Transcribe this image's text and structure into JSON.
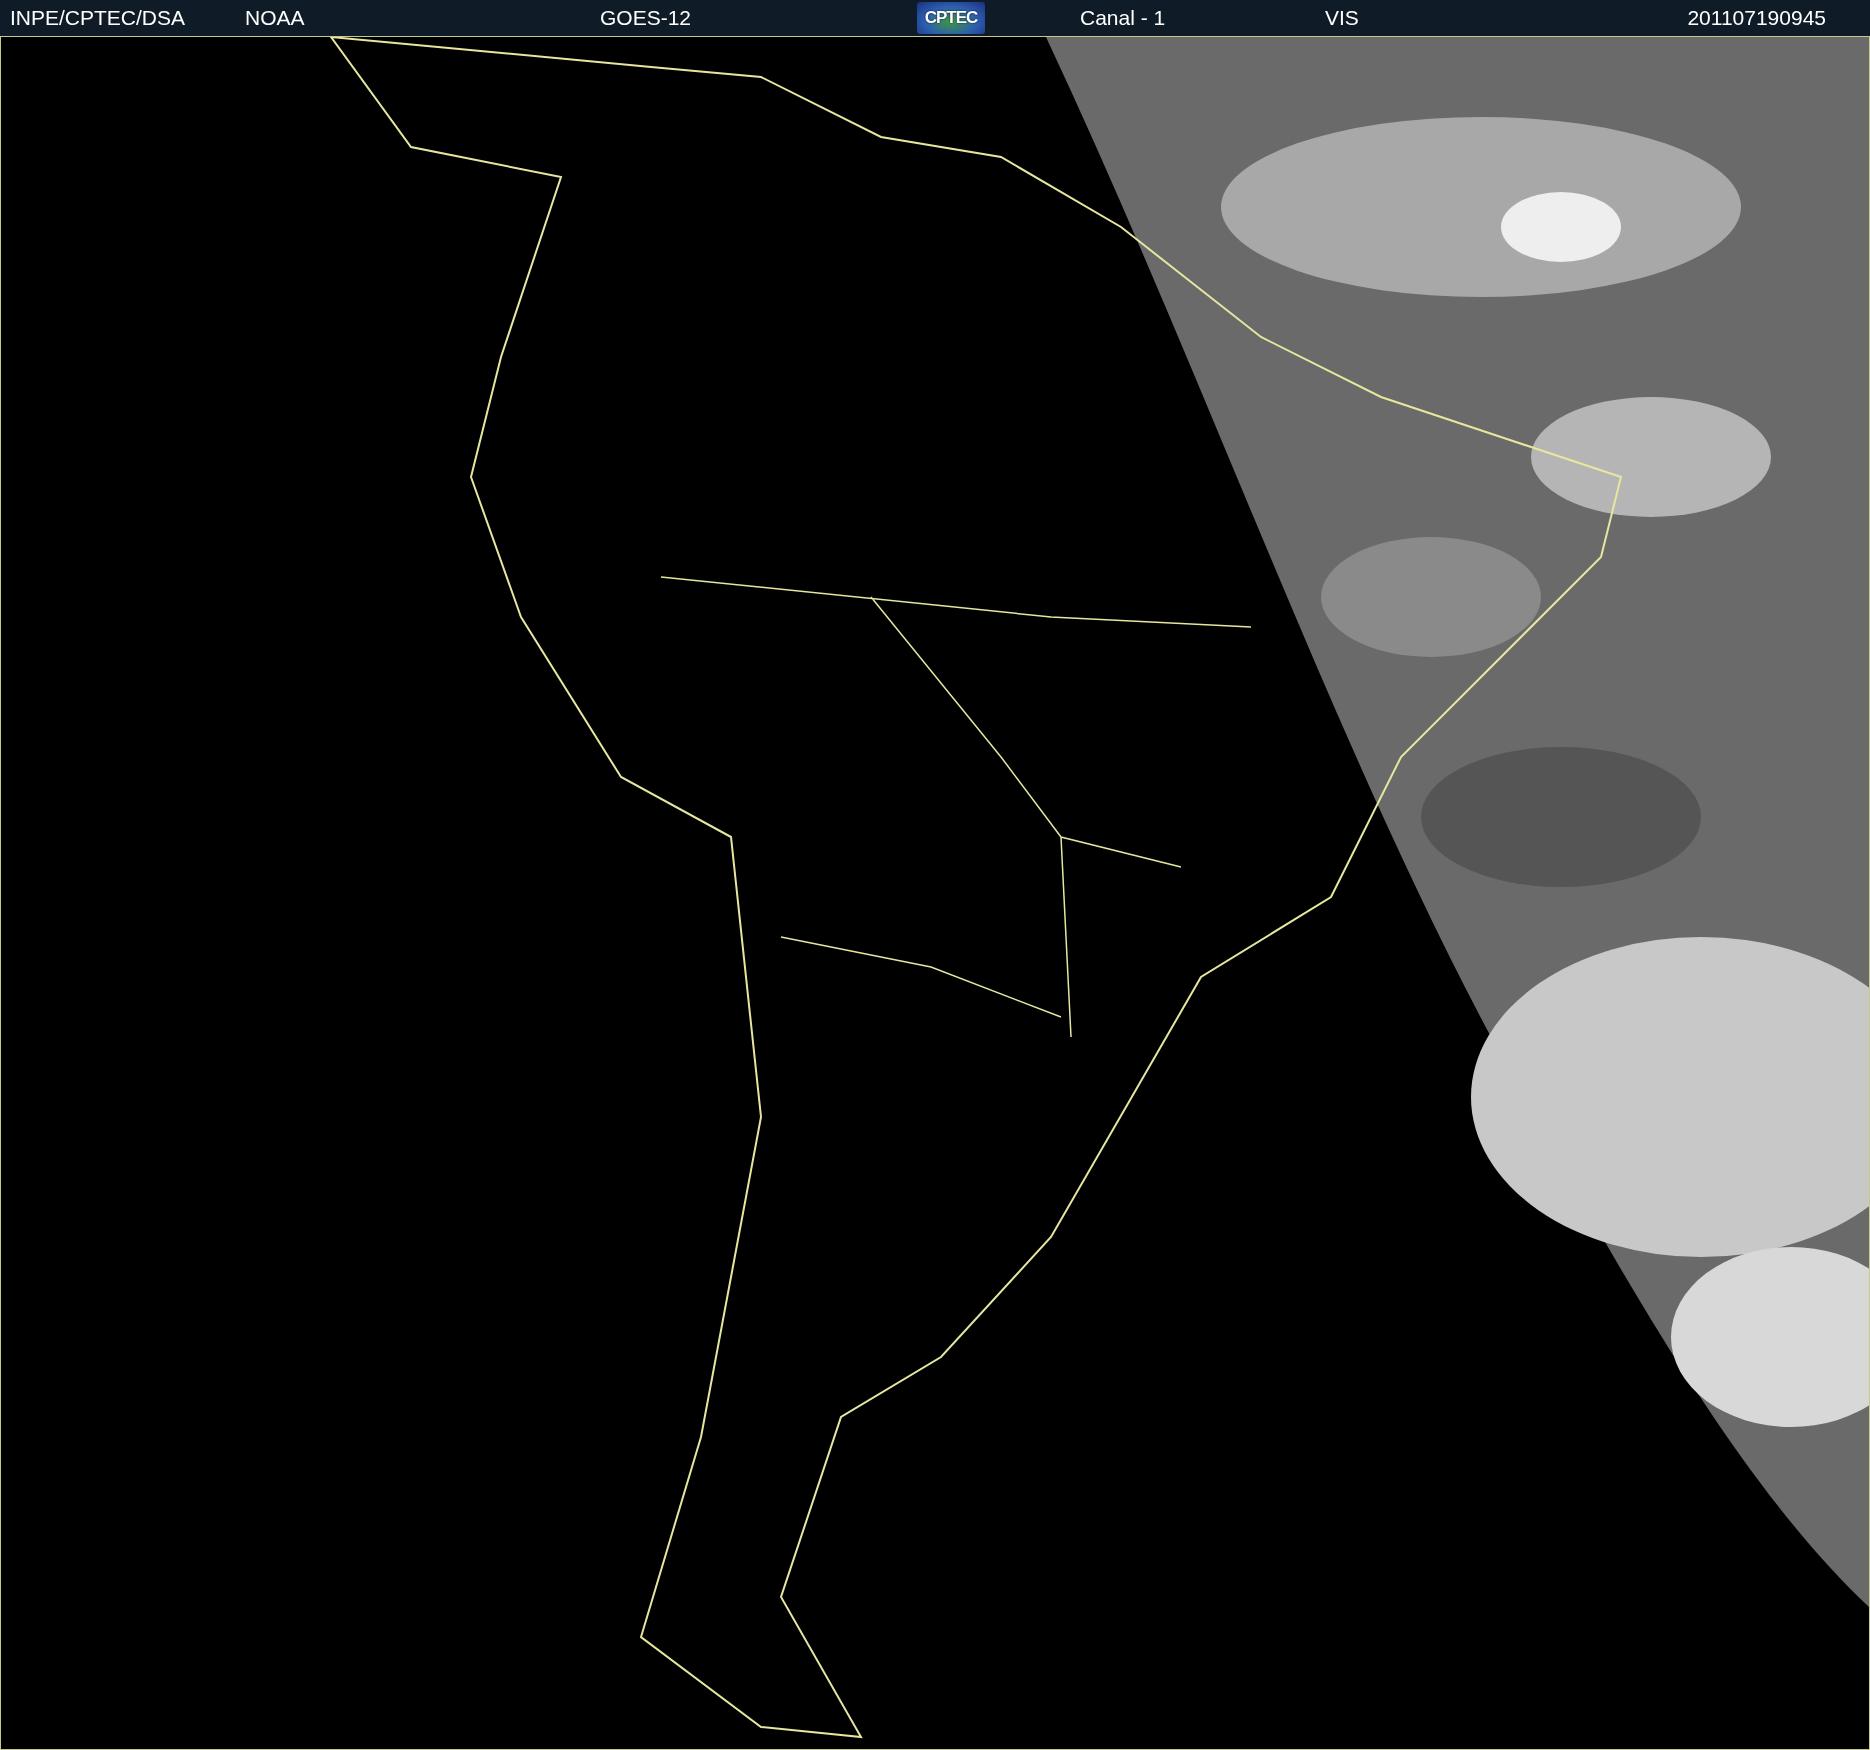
{
  "header": {
    "items": [
      {
        "kind": "text",
        "text": "INPE/CPTEC/DSA"
      },
      {
        "kind": "text",
        "text": "NOAA"
      },
      {
        "kind": "text",
        "text": "GOES-12"
      },
      {
        "kind": "logo",
        "text": "CPTEC"
      },
      {
        "kind": "text",
        "text": "Canal - 1"
      },
      {
        "kind": "text",
        "text": "VIS"
      },
      {
        "kind": "text",
        "text": "201107190945"
      }
    ]
  }
}
